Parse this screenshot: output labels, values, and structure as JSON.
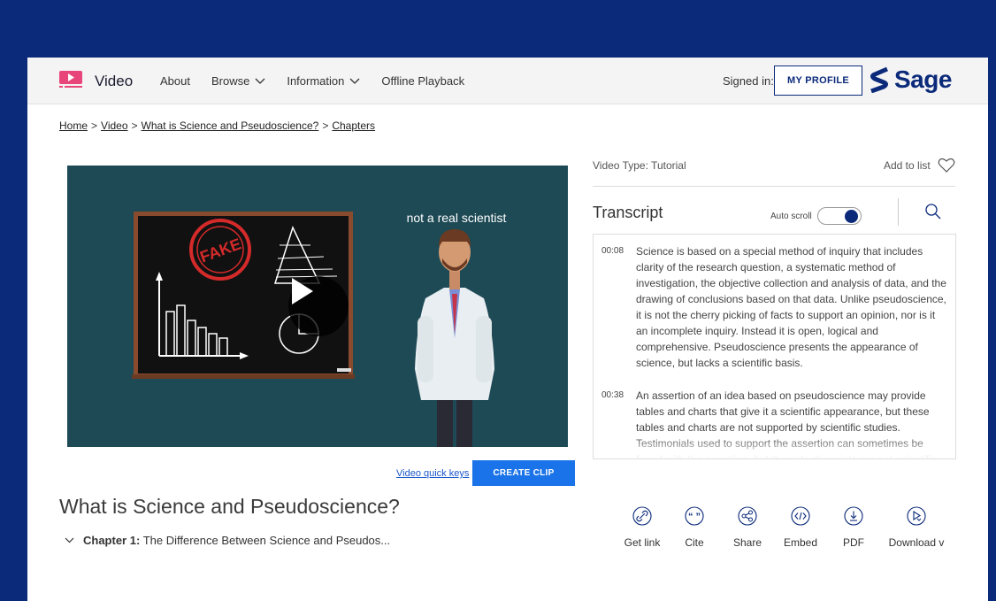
{
  "header": {
    "brand": "Video",
    "nav": [
      {
        "label": "About",
        "dropdown": false
      },
      {
        "label": "Browse",
        "dropdown": true
      },
      {
        "label": "Information",
        "dropdown": true
      },
      {
        "label": "Offline Playback",
        "dropdown": false
      }
    ],
    "signed_in_label": "Signed in:",
    "profile_button": "MY PROFILE",
    "sage_logo_text": "Sage"
  },
  "breadcrumb": [
    "Home",
    "Video",
    "What is Science and Pseudoscience?",
    "Chapters"
  ],
  "video": {
    "overlay_text": "not a real scientist",
    "stamp_text": "FAKE",
    "quick_keys": "Video quick keys",
    "create_clip": "CREATE CLIP",
    "title": "What is Science and Pseudoscience?",
    "chapter_label": "Chapter 1:",
    "chapter_title": "The Difference Between Science and Pseudos..."
  },
  "sidebar": {
    "video_type": "Video Type: Tutorial",
    "add_to_list": "Add to list",
    "transcript_heading": "Transcript",
    "auto_scroll_label": "Auto scroll",
    "auto_scroll_on": true,
    "entries": [
      {
        "time": "00:08",
        "text": "Science is based on a special method of inquiry that includes clarity of the research question, a systematic method of investigation, the objective collection and analysis of data, and the drawing of conclusions based on that data. Unlike pseudoscience, it is not the cherry picking of facts to support an opinion, nor is it an incomplete inquiry. Instead it is open, logical and comprehensive. Pseudoscience presents the appearance of science, but lacks a scientific basis."
      },
      {
        "time": "00:38",
        "text": "An assertion of an idea based on pseudoscience may provide tables and charts that give it a scientific appearance, but these tables and charts are not supported by scientific studies. Testimonials used to support the assertion can sometimes be found with the assertion, but these testimonials are not scientific. Products"
      }
    ]
  },
  "actions": [
    {
      "label": "Get link",
      "icon": "link-icon"
    },
    {
      "label": "Cite",
      "icon": "quote-icon"
    },
    {
      "label": "Share",
      "icon": "share-icon"
    },
    {
      "label": "Embed",
      "icon": "code-icon"
    },
    {
      "label": "PDF",
      "icon": "download-icon"
    },
    {
      "label": "Download v",
      "icon": "video-download-icon"
    }
  ],
  "colors": {
    "frame": "#0b2a7a",
    "accent": "#1a73e8",
    "video_bg": "#1d4a55",
    "logo_pink": "#e8457a"
  }
}
